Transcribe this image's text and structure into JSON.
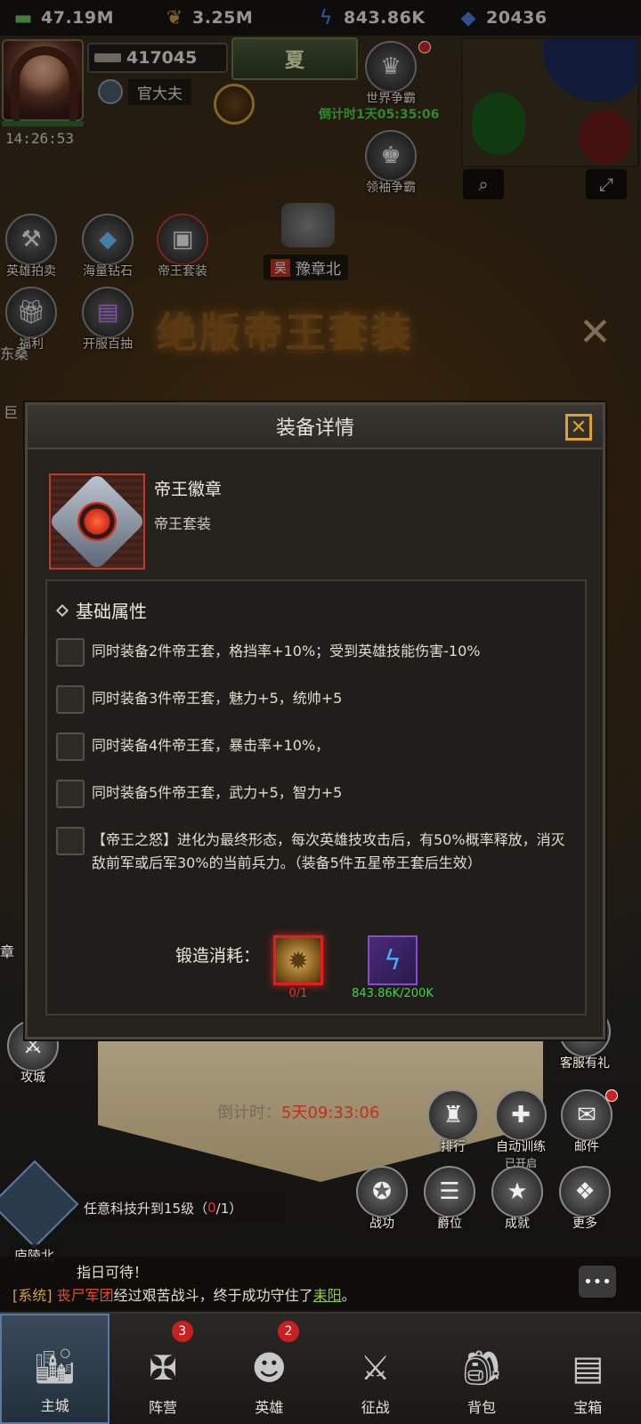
{
  "resources": [
    {
      "icon": "cash-icon",
      "value": "47.19M"
    },
    {
      "icon": "wheat-icon",
      "value": "3.25M"
    },
    {
      "icon": "lightning-icon",
      "value": "843.86K"
    },
    {
      "icon": "diamond-icon",
      "value": "20436"
    }
  ],
  "player": {
    "power": "417045",
    "title": "官大夫",
    "clock": "14:26:53",
    "season": "夏"
  },
  "events_right": {
    "world": "世界争霸",
    "world_timer": "倒计时1天05:35:06",
    "leader": "领袖争霸"
  },
  "events_left": [
    {
      "label": "英雄拍卖",
      "icon": "auction-icon"
    },
    {
      "label": "海量钻石",
      "icon": "diamond-pile-icon"
    },
    {
      "label": "帝王套装",
      "icon": "tank-icon"
    },
    {
      "label": "福利",
      "icon": "gift-icon"
    },
    {
      "label": "开服百抽",
      "icon": "cards-icon"
    }
  ],
  "map": {
    "city_label": "豫章北",
    "city_tag": "吴",
    "side_label": "东桑",
    "side_label2": "巨"
  },
  "promo": {
    "title": "绝版帝王套装"
  },
  "modal": {
    "title": "装备详情",
    "item_name": "帝王徽章",
    "item_set": "帝王套装",
    "section_title": "基础属性",
    "attributes": [
      "同时装备2件帝王套，格挡率+10%；受到英雄技能伤害-10%",
      "同时装备3件帝王套，魅力+5，统帅+5",
      "同时装备4件帝王套，暴击率+10%，",
      "同时装备5件帝王套，武力+5，智力+5",
      "【帝王之怒】进化为最终形态，每次英雄技攻击后，有50%概率释放，消灭敌前军或后军30%的当前兵力。（装备5件五星帝王套后生效）"
    ],
    "forge_label": "锻造消耗：",
    "materials": [
      {
        "icon": "emblem-icon",
        "count": "0/1"
      },
      {
        "icon": "lightning-icon",
        "count": "843.86K/200K"
      }
    ]
  },
  "right_buttons": [
    {
      "label": "客服有礼"
    },
    {
      "label": "排行"
    },
    {
      "label": "自动训练",
      "sub": "已开启"
    },
    {
      "label": "邮件"
    },
    {
      "label": "战功"
    },
    {
      "label": "爵位"
    },
    {
      "label": "成就"
    },
    {
      "label": "更多"
    }
  ],
  "left_bottom": {
    "attack": "攻城",
    "side": "章"
  },
  "countdown": {
    "label": "倒计时：",
    "value": "5天09:33:06"
  },
  "task": {
    "text": "任意科技升到15级（",
    "progress": "0",
    "total": "/1）"
  },
  "location": "庐陵北",
  "chat": {
    "line1": "指日可待！",
    "sys": "[系统]",
    "army": "丧尸军团",
    "mid": "经过艰苦战斗，终于成功守住了",
    "city": "耒阳",
    "end": "。"
  },
  "nav": [
    {
      "label": "主城",
      "badge": ""
    },
    {
      "label": "阵营",
      "badge": "3"
    },
    {
      "label": "英雄",
      "badge": "2"
    },
    {
      "label": "征战",
      "badge": ""
    },
    {
      "label": "背包",
      "badge": ""
    },
    {
      "label": "宝箱",
      "badge": ""
    }
  ],
  "colors": {
    "accent": "#e0a030",
    "danger": "#e03a2a",
    "success": "#4ad04a"
  }
}
